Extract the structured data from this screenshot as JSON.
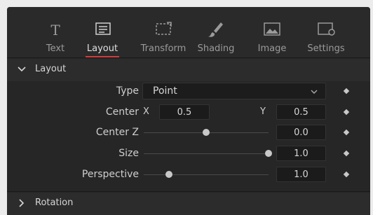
{
  "tabs": [
    {
      "label": "Text",
      "icon": "text-icon"
    },
    {
      "label": "Layout",
      "icon": "layout-icon"
    },
    {
      "label": "Transform",
      "icon": "transform-icon"
    },
    {
      "label": "Shading",
      "icon": "brush-icon"
    },
    {
      "label": "Image",
      "icon": "image-icon"
    },
    {
      "label": "Settings",
      "icon": "settings-icon"
    }
  ],
  "active_tab": "Layout",
  "colors": {
    "accent": "#d23c3c",
    "panel": "#262626"
  },
  "layout_section": {
    "title": "Layout",
    "type": {
      "label": "Type",
      "value": "Point"
    },
    "center": {
      "label": "Center",
      "x_label": "X",
      "x_value": "0.5",
      "y_label": "Y",
      "y_value": "0.5"
    },
    "center_z": {
      "label": "Center Z",
      "value": "0.0",
      "slider_fraction": 0.5
    },
    "size": {
      "label": "Size",
      "value": "1.0",
      "slider_fraction": 1.0
    },
    "perspective": {
      "label": "Perspective",
      "value": "1.0",
      "slider_fraction": 0.2
    }
  },
  "rotation_section": {
    "title": "Rotation"
  }
}
